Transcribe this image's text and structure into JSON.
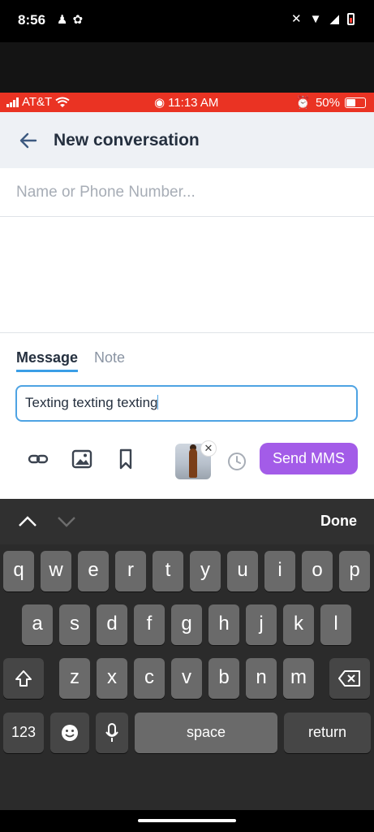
{
  "android_status": {
    "time": "8:56"
  },
  "ios_status": {
    "carrier": "AT&T",
    "time": "11:13 AM",
    "battery": "50%"
  },
  "header": {
    "title": "New conversation"
  },
  "recipient": {
    "placeholder": "Name or Phone Number...",
    "value": ""
  },
  "tabs": [
    {
      "label": "Message",
      "active": true
    },
    {
      "label": "Note",
      "active": false
    }
  ],
  "message": {
    "text": "Texting texting texting"
  },
  "toolbar": {
    "send_label": "Send MMS",
    "accent": "#a35ce8"
  },
  "keyboard": {
    "done_label": "Done",
    "row1": [
      "q",
      "w",
      "e",
      "r",
      "t",
      "y",
      "u",
      "i",
      "o",
      "p"
    ],
    "row2": [
      "a",
      "s",
      "d",
      "f",
      "g",
      "h",
      "j",
      "k",
      "l"
    ],
    "row3": [
      "z",
      "x",
      "c",
      "v",
      "b",
      "n",
      "m"
    ],
    "numbers_label": "123",
    "space_label": "space",
    "return_label": "return"
  },
  "colors": {
    "ios_bar": "#ea3323",
    "focus_border": "#4ea3e3",
    "tab_underline": "#3b9ee6"
  }
}
